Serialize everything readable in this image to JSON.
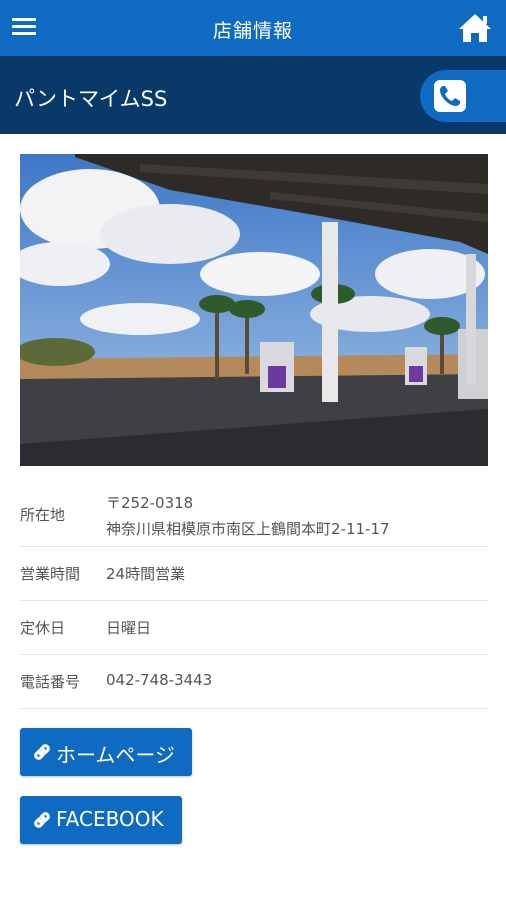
{
  "header": {
    "title": "店舗情報",
    "menu_icon": "hamburger-menu-icon",
    "home_icon": "home-icon"
  },
  "shop": {
    "name": "パントマイムSS",
    "call_icon": "phone-icon"
  },
  "info": {
    "address": {
      "label": "所在地",
      "postal": "〒252-0318",
      "line": "神奈川県相模原市南区上鶴間本町2-11-17"
    },
    "hours": {
      "label": "営業時間",
      "value": "24時間営業"
    },
    "closed": {
      "label": "定休日",
      "value": "日曜日"
    },
    "phone": {
      "label": "電話番号",
      "value": "042-748-3443"
    }
  },
  "links": {
    "homepage": {
      "label": "ホームページ",
      "icon": "link-icon"
    },
    "facebook": {
      "label": "FACEBOOK",
      "icon": "link-icon"
    }
  },
  "colors": {
    "primary": "#0f6bc1",
    "dark": "#083968"
  }
}
